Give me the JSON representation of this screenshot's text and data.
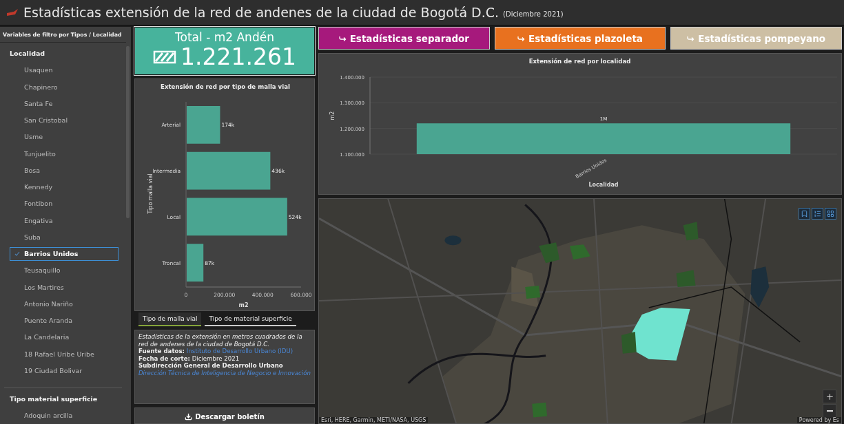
{
  "header": {
    "title": "Estadísticas extensión de la red de andenes de la ciudad de Bogotá D.C.",
    "subtitle": "(Diciembre 2021)"
  },
  "sidebar": {
    "title": "Variables de filtro por Tipos / Localidad",
    "groups": [
      {
        "title": "Localidad",
        "items": [
          {
            "label": "Usaquen",
            "selected": false
          },
          {
            "label": "Chapinero",
            "selected": false
          },
          {
            "label": "Santa Fe",
            "selected": false
          },
          {
            "label": "San Cristobal",
            "selected": false
          },
          {
            "label": "Usme",
            "selected": false
          },
          {
            "label": "Tunjuelito",
            "selected": false
          },
          {
            "label": "Bosa",
            "selected": false
          },
          {
            "label": "Kennedy",
            "selected": false
          },
          {
            "label": "Fontibon",
            "selected": false
          },
          {
            "label": "Engativa",
            "selected": false
          },
          {
            "label": "Suba",
            "selected": false
          },
          {
            "label": "Barrios Unidos",
            "selected": true
          },
          {
            "label": "Teusaquillo",
            "selected": false
          },
          {
            "label": "Los Martires",
            "selected": false
          },
          {
            "label": "Antonio Nariño",
            "selected": false
          },
          {
            "label": "Puente Aranda",
            "selected": false
          },
          {
            "label": "La Candelaria",
            "selected": false
          },
          {
            "label": "18 Rafael Uribe Uribe",
            "selected": false
          },
          {
            "label": "19 Ciudad Bolivar",
            "selected": false
          }
        ]
      },
      {
        "title": "Tipo material superficie",
        "items": [
          {
            "label": "Adoquin arcilla",
            "selected": false
          }
        ]
      }
    ]
  },
  "total": {
    "label": "Total - m2 Andén",
    "value": "1.221.261"
  },
  "malla_chart": {
    "chart_data": {
      "type": "bar",
      "orientation": "horizontal",
      "title": "Extensión de red por tipo de malla vial",
      "xlabel": "m2",
      "ylabel": "Tipo malla vial",
      "categories": [
        "Arterial",
        "Intermedia",
        "Local",
        "Troncal"
      ],
      "series": [
        {
          "color": "#4aa591",
          "values": [
            174000,
            436000,
            524000,
            87000
          ]
        }
      ],
      "xlim": [
        0,
        600000
      ],
      "xticks": [
        {
          "value": 0,
          "label": "0"
        },
        {
          "value": 200000,
          "label": "200.000"
        },
        {
          "value": 400000,
          "label": "400.000"
        },
        {
          "value": 600000,
          "label": "600.000"
        }
      ],
      "value_labels": [
        "174k",
        "436k",
        "524k",
        "87k"
      ]
    }
  },
  "tabs": [
    {
      "label": "Tipo de malla vial",
      "selected": true
    },
    {
      "label": "Tipo de material superficie",
      "selected": false
    }
  ],
  "info": {
    "description": "Estadísticas de la extensión en metros cuadrados de la red de andenes de la ciudad de Bogotá D.C.",
    "source_label": "Fuente datos:",
    "source_link": "Instituto de Desarrollo Urbano (IDU)",
    "date": "**Fecha de corte:** Diciembre 2021",
    "office": "Subdirección General de Desarrollo Urbano",
    "department": "Dirección Técnica de Inteligencia de Negocio e Innovación"
  },
  "download_button": "Descargar boletín",
  "link_buttons": [
    {
      "label": "Estadísticas separador",
      "color": "#a6197c"
    },
    {
      "label": "Estadísticas plazoleta",
      "color": "#e8711f"
    },
    {
      "label": "Estadísticas pompeyano",
      "color": "#cdbfa4"
    }
  ],
  "locality_chart": {
    "chart_data": {
      "type": "bar",
      "title": "Extensión de red por localidad",
      "xlabel": "Localidad",
      "ylabel": "m2",
      "categories": [
        "Barrios Unidos"
      ],
      "series": [
        {
          "color": "#4aa591",
          "values": [
            1220000
          ]
        }
      ],
      "ylim": [
        1100000,
        1400000
      ],
      "yticks": [
        {
          "value": 1100000,
          "label": "1.100.000"
        },
        {
          "value": 1200000,
          "label": "1.200.000"
        },
        {
          "value": 1300000,
          "label": "1.300.000"
        },
        {
          "value": 1400000,
          "label": "1.400.000"
        }
      ],
      "value_labels": [
        "1M"
      ]
    }
  },
  "map": {
    "kind": "picture",
    "attribution": "Esri, HERE, Garmin, METI/NASA, USGS",
    "powered_by": "Powered by Es"
  }
}
